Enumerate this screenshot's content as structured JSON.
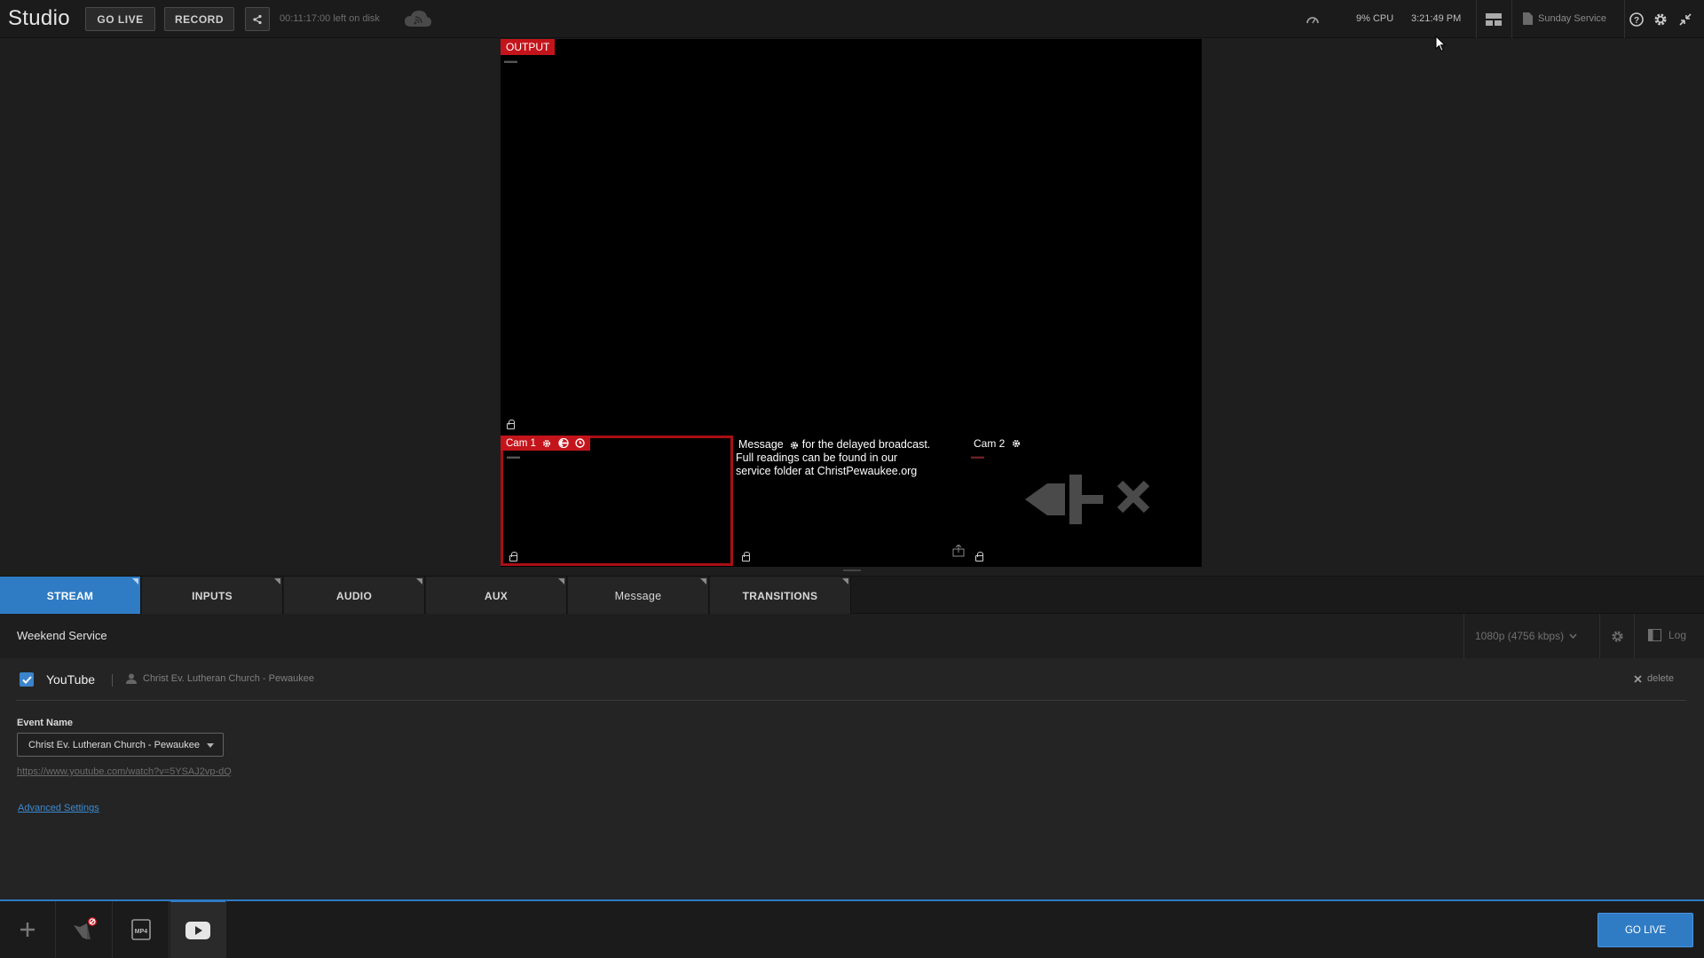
{
  "app": {
    "title": "Studio"
  },
  "topbar": {
    "go_live_label": "GO LIVE",
    "record_label": "RECORD",
    "disk_status": "00:11:17:00 left on disk",
    "cpu": "9% CPU",
    "clock": "3:21:49 PM",
    "project_name": "Sunday Service",
    "icons": [
      "share-icon",
      "cloud-stream-icon",
      "performance-gauge-icon",
      "layout-icon",
      "document-icon",
      "help-icon",
      "gear-icon",
      "collapse-icon"
    ]
  },
  "preview": {
    "output_label": "OUTPUT",
    "cam1_label": "Cam 1",
    "message_label": "Message",
    "message_text_1": "for the delayed broadcast.",
    "message_text_2": "Full readings can be found in our",
    "message_text_3": "service folder at ChristPewaukee.org",
    "cam2_label": "Cam 2"
  },
  "tabs": [
    {
      "label": "STREAM",
      "active": true
    },
    {
      "label": "INPUTS",
      "active": false
    },
    {
      "label": "AUDIO",
      "active": false
    },
    {
      "label": "AUX",
      "active": false
    },
    {
      "label": "Message",
      "active": false
    },
    {
      "label": "TRANSITIONS",
      "active": false
    }
  ],
  "stream": {
    "profile_name": "Weekend Service",
    "quality": "1080p (4756 kbps)",
    "log_label": "Log",
    "destination": {
      "service": "YouTube",
      "enabled": true,
      "account": "Christ Ev. Lutheran Church - Pewaukee",
      "delete_label": "delete"
    },
    "event_name_label": "Event Name",
    "event_name_value": "Christ Ev. Lutheran Church - Pewaukee",
    "watch_url": "https://www.youtube.com/watch?v=5YSAJ2vp-dQ",
    "advanced_settings_label": "Advanced Settings"
  },
  "bottombar": {
    "go_live_label": "GO LIVE",
    "destination_icons": [
      "add-icon",
      "facebook-disabled-icon",
      "mp4-icon",
      "youtube-icon"
    ]
  },
  "colors": {
    "accent": "#2f7bc4",
    "live_red": "#c4141b"
  }
}
